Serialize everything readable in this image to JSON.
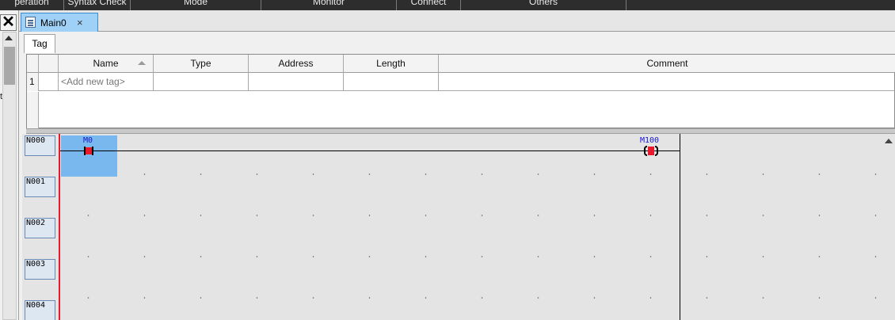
{
  "toolbar": {
    "groups": [
      "peration",
      "Syntax Check",
      "Mode",
      "Monitor",
      "Connect",
      "Others"
    ]
  },
  "left_panel": {
    "close_glyph": "✕",
    "cut_text": "t"
  },
  "tabs": {
    "main_label": "Main0",
    "close_glyph": "×"
  },
  "subtabs": {
    "tag_label": "Tag"
  },
  "tag_table": {
    "columns": [
      "Name",
      "Type",
      "Address",
      "Length",
      "Comment"
    ],
    "rows": [
      {
        "num": "1",
        "name_placeholder": "<Add new tag>"
      }
    ]
  },
  "ladder": {
    "rungs": [
      "N000",
      "N001",
      "N002",
      "N003",
      "N004"
    ],
    "contact_label": "M0",
    "coil_label": "M100"
  },
  "colors": {
    "accent_tab": "#9fd0f5",
    "selection": "#79b8ee",
    "rail": "#e8192c",
    "device_label": "#1818cc"
  }
}
